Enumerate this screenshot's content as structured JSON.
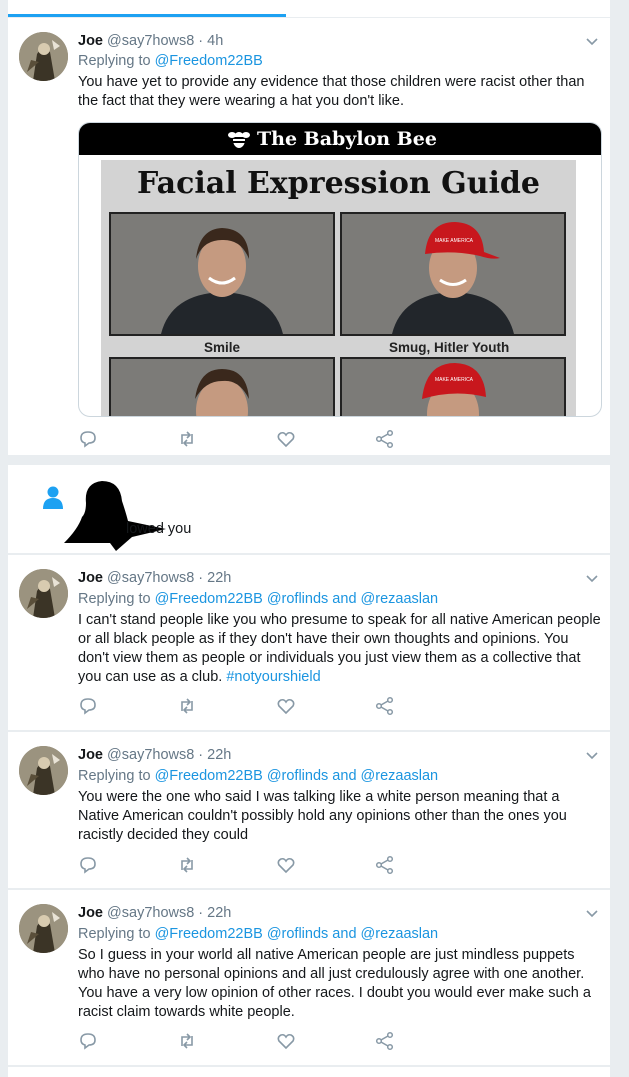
{
  "tweets": [
    {
      "name": "Joe",
      "handle": "@say7hows8",
      "time": "4h",
      "replying_prefix": "Replying to",
      "replying_to": "@Freedom22BB",
      "text": "You have yet to provide any evidence that those children were racist other than the fact that they were wearing a hat you don't like.",
      "embed": {
        "banner": "The Babylon Bee",
        "title": "Facial Expression Guide",
        "labels": [
          "Smile",
          "Smug, Hitler Youth"
        ],
        "hat_text": "MAKE AMERICA GREAT AGAIN"
      }
    },
    {
      "name": "Joe",
      "handle": "@say7hows8",
      "time": "22h",
      "replying_prefix": "Replying to",
      "replying_to": "@Freedom22BB @roflinds and @rezaaslan",
      "text": "I can't stand people like you who presume to speak for all native American people or all black people as if they don't have their own thoughts and opinions. You don't view them as people or individuals you just view them as a collective that you can use as a club.",
      "hashtag": "#notyourshield"
    },
    {
      "name": "Joe",
      "handle": "@say7hows8",
      "time": "22h",
      "replying_prefix": "Replying to",
      "replying_to": "@Freedom22BB @roflinds and @rezaaslan",
      "text": "You were the one who said I was talking like a white person meaning that a Native American couldn't possibly hold any opinions other than the ones you racistly decided they could"
    },
    {
      "name": "Joe",
      "handle": "@say7hows8",
      "time": "22h",
      "replying_prefix": "Replying to",
      "replying_to": "@Freedom22BB @roflinds and @rezaaslan",
      "text": "So I guess in your world all native American people are just mindless puppets who have no personal opinions and all just credulously agree with one another. You have a very low opinion of other races. I doubt you would ever make such a racist claim towards white people."
    }
  ],
  "follow_notification": {
    "text": "lowed you"
  },
  "colors": {
    "accent": "#1da1f2",
    "link": "#1b95e0",
    "muted": "#657786",
    "background": "#e9edf0"
  },
  "icons": [
    "reply-icon",
    "retweet-icon",
    "like-icon",
    "share-icon",
    "chevron-down-icon",
    "person-icon"
  ]
}
